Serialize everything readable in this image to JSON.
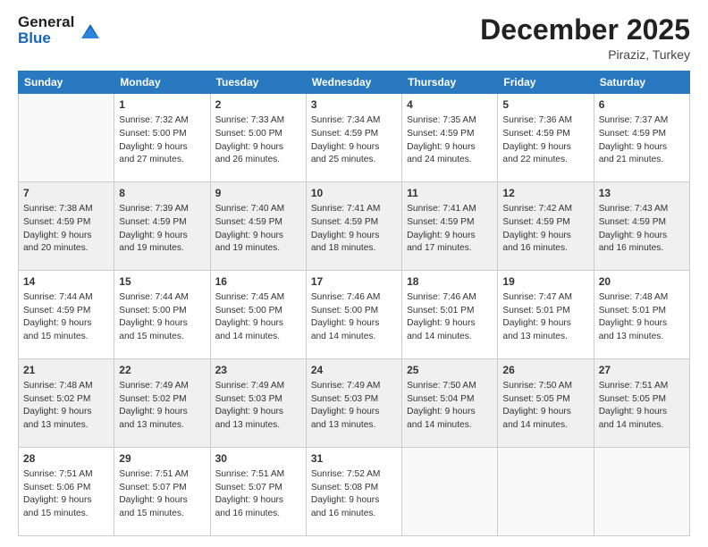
{
  "header": {
    "logo_line1": "General",
    "logo_line2": "Blue",
    "month": "December 2025",
    "location": "Piraziz, Turkey"
  },
  "weekdays": [
    "Sunday",
    "Monday",
    "Tuesday",
    "Wednesday",
    "Thursday",
    "Friday",
    "Saturday"
  ],
  "weeks": [
    [
      {
        "day": "",
        "info": ""
      },
      {
        "day": "1",
        "info": "Sunrise: 7:32 AM\nSunset: 5:00 PM\nDaylight: 9 hours\nand 27 minutes."
      },
      {
        "day": "2",
        "info": "Sunrise: 7:33 AM\nSunset: 5:00 PM\nDaylight: 9 hours\nand 26 minutes."
      },
      {
        "day": "3",
        "info": "Sunrise: 7:34 AM\nSunset: 4:59 PM\nDaylight: 9 hours\nand 25 minutes."
      },
      {
        "day": "4",
        "info": "Sunrise: 7:35 AM\nSunset: 4:59 PM\nDaylight: 9 hours\nand 24 minutes."
      },
      {
        "day": "5",
        "info": "Sunrise: 7:36 AM\nSunset: 4:59 PM\nDaylight: 9 hours\nand 22 minutes."
      },
      {
        "day": "6",
        "info": "Sunrise: 7:37 AM\nSunset: 4:59 PM\nDaylight: 9 hours\nand 21 minutes."
      }
    ],
    [
      {
        "day": "7",
        "info": "Sunrise: 7:38 AM\nSunset: 4:59 PM\nDaylight: 9 hours\nand 20 minutes."
      },
      {
        "day": "8",
        "info": "Sunrise: 7:39 AM\nSunset: 4:59 PM\nDaylight: 9 hours\nand 19 minutes."
      },
      {
        "day": "9",
        "info": "Sunrise: 7:40 AM\nSunset: 4:59 PM\nDaylight: 9 hours\nand 19 minutes."
      },
      {
        "day": "10",
        "info": "Sunrise: 7:41 AM\nSunset: 4:59 PM\nDaylight: 9 hours\nand 18 minutes."
      },
      {
        "day": "11",
        "info": "Sunrise: 7:41 AM\nSunset: 4:59 PM\nDaylight: 9 hours\nand 17 minutes."
      },
      {
        "day": "12",
        "info": "Sunrise: 7:42 AM\nSunset: 4:59 PM\nDaylight: 9 hours\nand 16 minutes."
      },
      {
        "day": "13",
        "info": "Sunrise: 7:43 AM\nSunset: 4:59 PM\nDaylight: 9 hours\nand 16 minutes."
      }
    ],
    [
      {
        "day": "14",
        "info": "Sunrise: 7:44 AM\nSunset: 4:59 PM\nDaylight: 9 hours\nand 15 minutes."
      },
      {
        "day": "15",
        "info": "Sunrise: 7:44 AM\nSunset: 5:00 PM\nDaylight: 9 hours\nand 15 minutes."
      },
      {
        "day": "16",
        "info": "Sunrise: 7:45 AM\nSunset: 5:00 PM\nDaylight: 9 hours\nand 14 minutes."
      },
      {
        "day": "17",
        "info": "Sunrise: 7:46 AM\nSunset: 5:00 PM\nDaylight: 9 hours\nand 14 minutes."
      },
      {
        "day": "18",
        "info": "Sunrise: 7:46 AM\nSunset: 5:01 PM\nDaylight: 9 hours\nand 14 minutes."
      },
      {
        "day": "19",
        "info": "Sunrise: 7:47 AM\nSunset: 5:01 PM\nDaylight: 9 hours\nand 13 minutes."
      },
      {
        "day": "20",
        "info": "Sunrise: 7:48 AM\nSunset: 5:01 PM\nDaylight: 9 hours\nand 13 minutes."
      }
    ],
    [
      {
        "day": "21",
        "info": "Sunrise: 7:48 AM\nSunset: 5:02 PM\nDaylight: 9 hours\nand 13 minutes."
      },
      {
        "day": "22",
        "info": "Sunrise: 7:49 AM\nSunset: 5:02 PM\nDaylight: 9 hours\nand 13 minutes."
      },
      {
        "day": "23",
        "info": "Sunrise: 7:49 AM\nSunset: 5:03 PM\nDaylight: 9 hours\nand 13 minutes."
      },
      {
        "day": "24",
        "info": "Sunrise: 7:49 AM\nSunset: 5:03 PM\nDaylight: 9 hours\nand 13 minutes."
      },
      {
        "day": "25",
        "info": "Sunrise: 7:50 AM\nSunset: 5:04 PM\nDaylight: 9 hours\nand 14 minutes."
      },
      {
        "day": "26",
        "info": "Sunrise: 7:50 AM\nSunset: 5:05 PM\nDaylight: 9 hours\nand 14 minutes."
      },
      {
        "day": "27",
        "info": "Sunrise: 7:51 AM\nSunset: 5:05 PM\nDaylight: 9 hours\nand 14 minutes."
      }
    ],
    [
      {
        "day": "28",
        "info": "Sunrise: 7:51 AM\nSunset: 5:06 PM\nDaylight: 9 hours\nand 15 minutes."
      },
      {
        "day": "29",
        "info": "Sunrise: 7:51 AM\nSunset: 5:07 PM\nDaylight: 9 hours\nand 15 minutes."
      },
      {
        "day": "30",
        "info": "Sunrise: 7:51 AM\nSunset: 5:07 PM\nDaylight: 9 hours\nand 16 minutes."
      },
      {
        "day": "31",
        "info": "Sunrise: 7:52 AM\nSunset: 5:08 PM\nDaylight: 9 hours\nand 16 minutes."
      },
      {
        "day": "",
        "info": ""
      },
      {
        "day": "",
        "info": ""
      },
      {
        "day": "",
        "info": ""
      }
    ]
  ]
}
